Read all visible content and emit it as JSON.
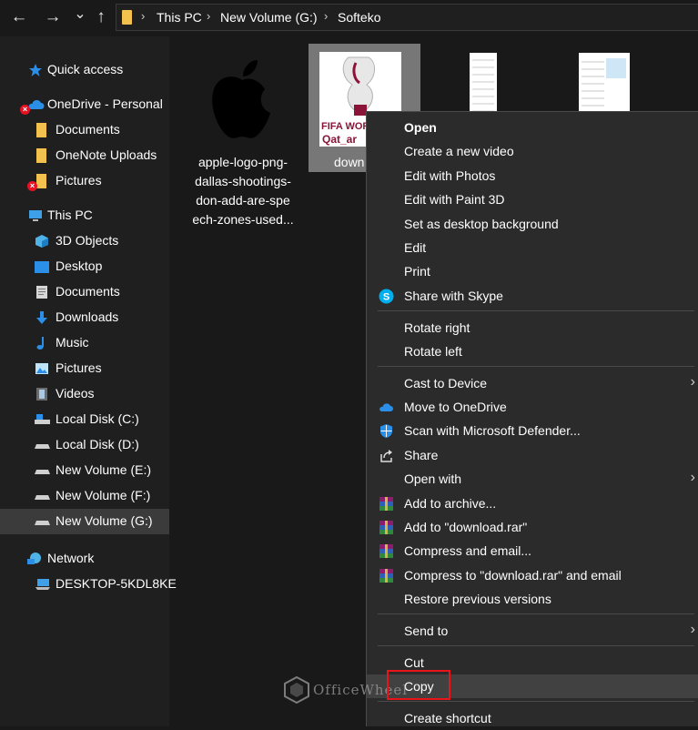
{
  "nav": {
    "back": "←",
    "forward": "→",
    "recent": "⌄",
    "up": "↑"
  },
  "breadcrumb": {
    "items": [
      "This PC",
      "New Volume (G:)",
      "Softeko"
    ]
  },
  "sidebar": {
    "items": [
      {
        "label": "Quick access",
        "icon": "star-icon"
      },
      {
        "label": "OneDrive - Personal",
        "icon": "cloud-icon"
      },
      {
        "label": "Documents",
        "icon": "folder-icon"
      },
      {
        "label": "OneNote Uploads",
        "icon": "folder-icon"
      },
      {
        "label": "Pictures",
        "icon": "folder-icon"
      },
      {
        "label": "This PC",
        "icon": "computer-icon"
      },
      {
        "label": "3D Objects",
        "icon": "cube-icon"
      },
      {
        "label": "Desktop",
        "icon": "desktop-icon"
      },
      {
        "label": "Documents",
        "icon": "document-icon"
      },
      {
        "label": "Downloads",
        "icon": "download-arrow-icon"
      },
      {
        "label": "Music",
        "icon": "music-note-icon"
      },
      {
        "label": "Pictures",
        "icon": "picture-icon"
      },
      {
        "label": "Videos",
        "icon": "film-icon"
      },
      {
        "label": "Local Disk (C:)",
        "icon": "drive-icon"
      },
      {
        "label": "Local Disk (D:)",
        "icon": "drive-icon"
      },
      {
        "label": "New Volume (E:)",
        "icon": "drive-icon"
      },
      {
        "label": "New Volume (F:)",
        "icon": "drive-icon"
      },
      {
        "label": "New Volume (G:)",
        "icon": "drive-icon"
      },
      {
        "label": "Network",
        "icon": "network-icon"
      },
      {
        "label": "DESKTOP-5KDL8KE",
        "icon": "computer-icon"
      }
    ]
  },
  "files": [
    {
      "label_lines": [
        "apple-logo-png-",
        "dallas-shootings-",
        "don-add-are-spe",
        "ech-zones-used..."
      ]
    },
    {
      "label": "down"
    }
  ],
  "fifa_thumb": {
    "line1": "FIFA WORL",
    "line2": "Qat_ar"
  },
  "menu": {
    "items": [
      "Open",
      "Create a new video",
      "Edit with Photos",
      "Edit with Paint 3D",
      "Set as desktop background",
      "Edit",
      "Print",
      "Share with Skype",
      "Rotate right",
      "Rotate left",
      "Cast to Device",
      "Move to OneDrive",
      "Scan with Microsoft Defender...",
      "Share",
      "Open with",
      "Add to archive...",
      "Add to \"download.rar\"",
      "Compress and email...",
      "Compress to \"download.rar\" and email",
      "Restore previous versions",
      "Send to",
      "Cut",
      "Copy",
      "Create shortcut"
    ]
  },
  "watermark": {
    "text": "OfficeWheel"
  },
  "colors": {
    "highlight": "#e8141a",
    "folder": "#f2c14e",
    "accent": "#2b8fe8"
  }
}
